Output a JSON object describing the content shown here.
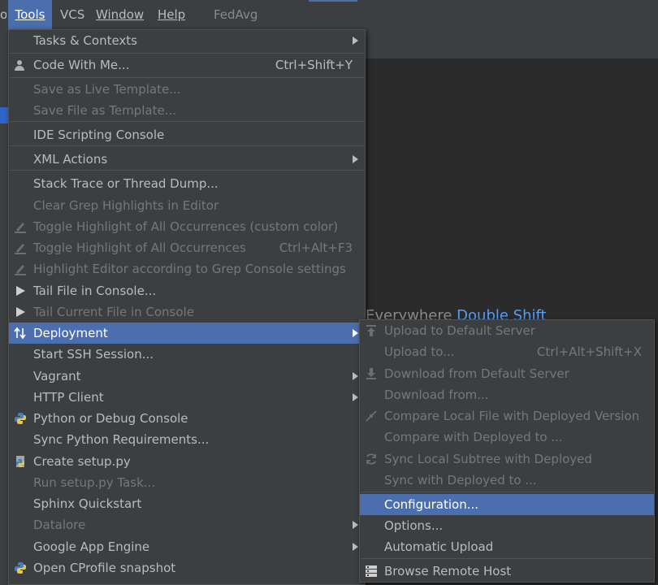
{
  "menubar": {
    "items": [
      "Tools",
      "VCS",
      "Window",
      "Help"
    ],
    "project": "FedAvg",
    "left_fragment": "o"
  },
  "hint": {
    "text": "Everywhere ",
    "key": "Double Shift"
  },
  "tools_menu": {
    "items": [
      {
        "label": "Tasks & Contexts",
        "shortcut": "",
        "submenu": true,
        "disabled": false,
        "icon": ""
      },
      {
        "label": "Code With Me...",
        "shortcut": "Ctrl+Shift+Y",
        "submenu": false,
        "disabled": false,
        "icon": "user-icon"
      },
      {
        "label": "Save as Live Template...",
        "shortcut": "",
        "submenu": false,
        "disabled": true,
        "icon": ""
      },
      {
        "label": "Save File as Template...",
        "shortcut": "",
        "submenu": false,
        "disabled": true,
        "icon": ""
      },
      {
        "label": "IDE Scripting Console",
        "shortcut": "",
        "submenu": false,
        "disabled": false,
        "icon": ""
      },
      {
        "label": "XML Actions",
        "shortcut": "",
        "submenu": true,
        "disabled": false,
        "icon": ""
      },
      {
        "label": "Stack Trace or Thread Dump...",
        "shortcut": "",
        "submenu": false,
        "disabled": false,
        "icon": ""
      },
      {
        "label": "Clear Grep Highlights in Editor",
        "shortcut": "",
        "submenu": false,
        "disabled": true,
        "icon": ""
      },
      {
        "label": "Toggle Highlight of All Occurrences (custom color)",
        "shortcut": "",
        "submenu": false,
        "disabled": true,
        "icon": "highlighter-icon"
      },
      {
        "label": "Toggle Highlight of All Occurrences",
        "shortcut": "Ctrl+Alt+F3",
        "submenu": false,
        "disabled": true,
        "icon": "highlighter-icon"
      },
      {
        "label": "Highlight Editor according to Grep Console settings",
        "shortcut": "",
        "submenu": false,
        "disabled": true,
        "icon": "highlighter-icon"
      },
      {
        "label": "Tail File in Console...",
        "shortcut": "",
        "submenu": false,
        "disabled": false,
        "icon": "play-icon"
      },
      {
        "label": "Tail Current File in Console",
        "shortcut": "",
        "submenu": false,
        "disabled": true,
        "icon": "play-icon"
      },
      {
        "label": "Deployment",
        "shortcut": "",
        "submenu": true,
        "disabled": false,
        "icon": "transfer-icon"
      },
      {
        "label": "Start SSH Session...",
        "shortcut": "",
        "submenu": false,
        "disabled": false,
        "icon": ""
      },
      {
        "label": "Vagrant",
        "shortcut": "",
        "submenu": true,
        "disabled": false,
        "icon": ""
      },
      {
        "label": "HTTP Client",
        "shortcut": "",
        "submenu": true,
        "disabled": false,
        "icon": ""
      },
      {
        "label": "Python or Debug Console",
        "shortcut": "",
        "submenu": false,
        "disabled": false,
        "icon": "python-icon"
      },
      {
        "label": "Sync Python Requirements...",
        "shortcut": "",
        "submenu": false,
        "disabled": false,
        "icon": ""
      },
      {
        "label": "Create setup.py",
        "shortcut": "",
        "submenu": false,
        "disabled": false,
        "icon": "python-file-icon"
      },
      {
        "label": "Run setup.py Task...",
        "shortcut": "",
        "submenu": false,
        "disabled": true,
        "icon": ""
      },
      {
        "label": "Sphinx Quickstart",
        "shortcut": "",
        "submenu": false,
        "disabled": false,
        "icon": ""
      },
      {
        "label": "Datalore",
        "shortcut": "",
        "submenu": true,
        "disabled": true,
        "icon": ""
      },
      {
        "label": "Google App Engine",
        "shortcut": "",
        "submenu": true,
        "disabled": false,
        "icon": ""
      },
      {
        "label": "Open CProfile snapshot",
        "shortcut": "",
        "submenu": false,
        "disabled": false,
        "icon": "python-icon"
      }
    ]
  },
  "deployment_menu": {
    "items": [
      {
        "label": "Upload to Default Server",
        "shortcut": "",
        "disabled": true,
        "icon": "upload-icon"
      },
      {
        "label": "Upload to...",
        "shortcut": "Ctrl+Alt+Shift+X",
        "disabled": true,
        "icon": ""
      },
      {
        "label": "Download from Default Server",
        "shortcut": "",
        "disabled": true,
        "icon": "download-icon"
      },
      {
        "label": "Download from...",
        "shortcut": "",
        "disabled": true,
        "icon": ""
      },
      {
        "label": "Compare Local File with Deployed Version",
        "shortcut": "",
        "disabled": true,
        "icon": "compare-icon"
      },
      {
        "label": "Compare with Deployed to ...",
        "shortcut": "",
        "disabled": true,
        "icon": ""
      },
      {
        "label": "Sync Local Subtree with Deployed",
        "shortcut": "",
        "disabled": true,
        "icon": "sync-icon"
      },
      {
        "label": "Sync with Deployed to ...",
        "shortcut": "",
        "disabled": true,
        "icon": ""
      },
      {
        "label": "Configuration...",
        "shortcut": "",
        "disabled": false,
        "icon": ""
      },
      {
        "label": "Options...",
        "shortcut": "",
        "disabled": false,
        "icon": ""
      },
      {
        "label": "Automatic Upload",
        "shortcut": "",
        "disabled": false,
        "icon": ""
      },
      {
        "label": "Browse Remote Host",
        "shortcut": "",
        "disabled": false,
        "icon": "server-icon"
      }
    ]
  }
}
